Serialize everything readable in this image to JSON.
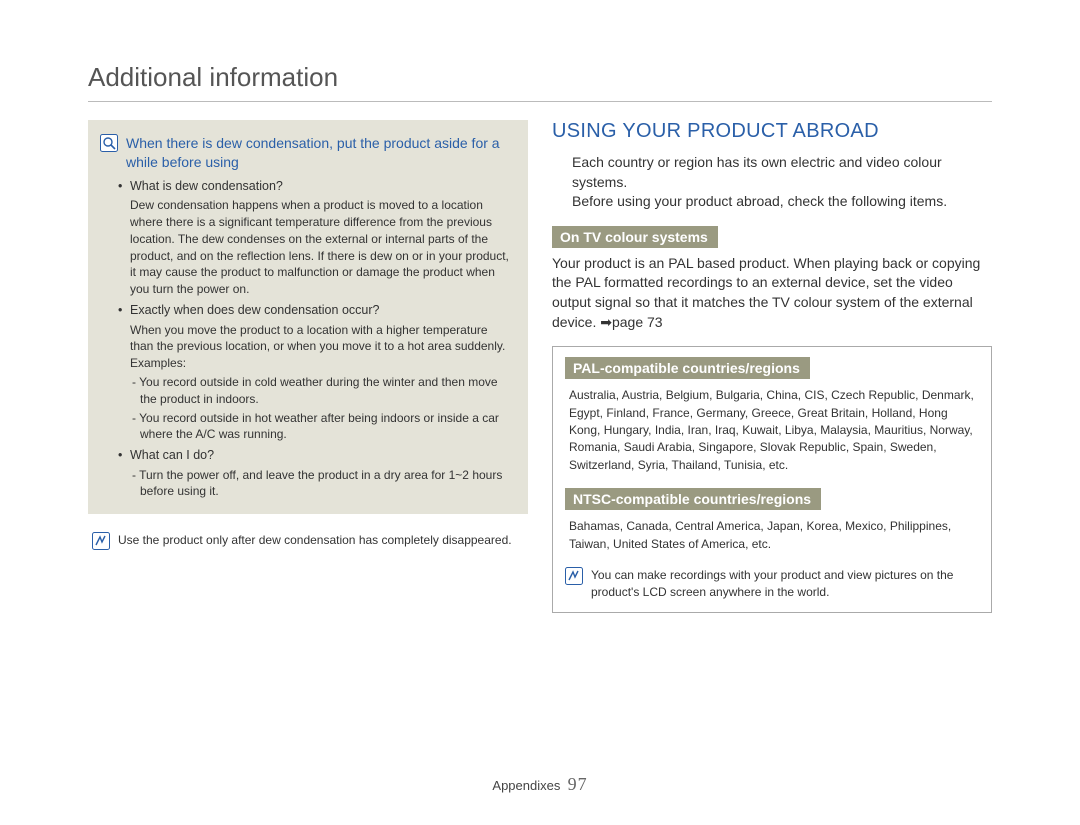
{
  "page_title": "Additional information",
  "left": {
    "callout_title": "When there is dew condensation, put the product aside for a while before using",
    "q1": "What is dew condensation?",
    "a1": "Dew condensation happens when a product is moved to a location where there is a significant temperature difference from the previous location. The dew condenses on the external or internal parts of the product, and on the reflection lens. If there is dew on or in your product, it may cause the product to malfunction or damage the product when you turn the power on.",
    "q2": "Exactly when does dew condensation occur?",
    "a2": "When you move the product to a location with a higher temperature than the previous location, or when you move it to a hot area suddenly. Examples:",
    "a2_sub1": "- You record outside in cold weather during the winter and then move the product in indoors.",
    "a2_sub2": "- You record outside in hot weather after being indoors or inside a car where the A/C was running.",
    "q3": "What can I do?",
    "a3": "- Turn the power off, and leave the product in a dry area for 1~2 hours before using it.",
    "note": "Use the product only after dew condensation has completely disappeared."
  },
  "right": {
    "heading": "USING YOUR PRODUCT ABROAD",
    "intro1": "Each country or region has its own electric and video colour systems.",
    "intro2": "Before using your product abroad, check the following items.",
    "sec1_label": "On TV colour systems",
    "sec1_body_a": "Your product is an PAL based product. When playing back or copying the PAL formatted recordings to an external device, set the video output signal so that it matches the TV colour system of the external device. ",
    "sec1_body_b": "page 73",
    "sec2_label": "PAL-compatible countries/regions",
    "sec2_body": "Australia, Austria, Belgium, Bulgaria, China, CIS, Czech Republic, Denmark, Egypt, Finland, France, Germany, Greece, Great Britain, Holland, Hong Kong, Hungary, India, Iran, Iraq, Kuwait, Libya, Malaysia, Mauritius, Norway, Romania, Saudi Arabia, Singapore, Slovak Republic, Spain, Sweden, Switzerland, Syria, Thailand, Tunisia, etc.",
    "sec3_label": "NTSC-compatible countries/regions",
    "sec3_body": "Bahamas, Canada, Central America, Japan, Korea, Mexico, Philippines, Taiwan, United States of America, etc.",
    "note": "You can make recordings with your product and view pictures on the product's LCD screen anywhere in the world."
  },
  "footer": {
    "section": "Appendixes",
    "page": "97"
  }
}
